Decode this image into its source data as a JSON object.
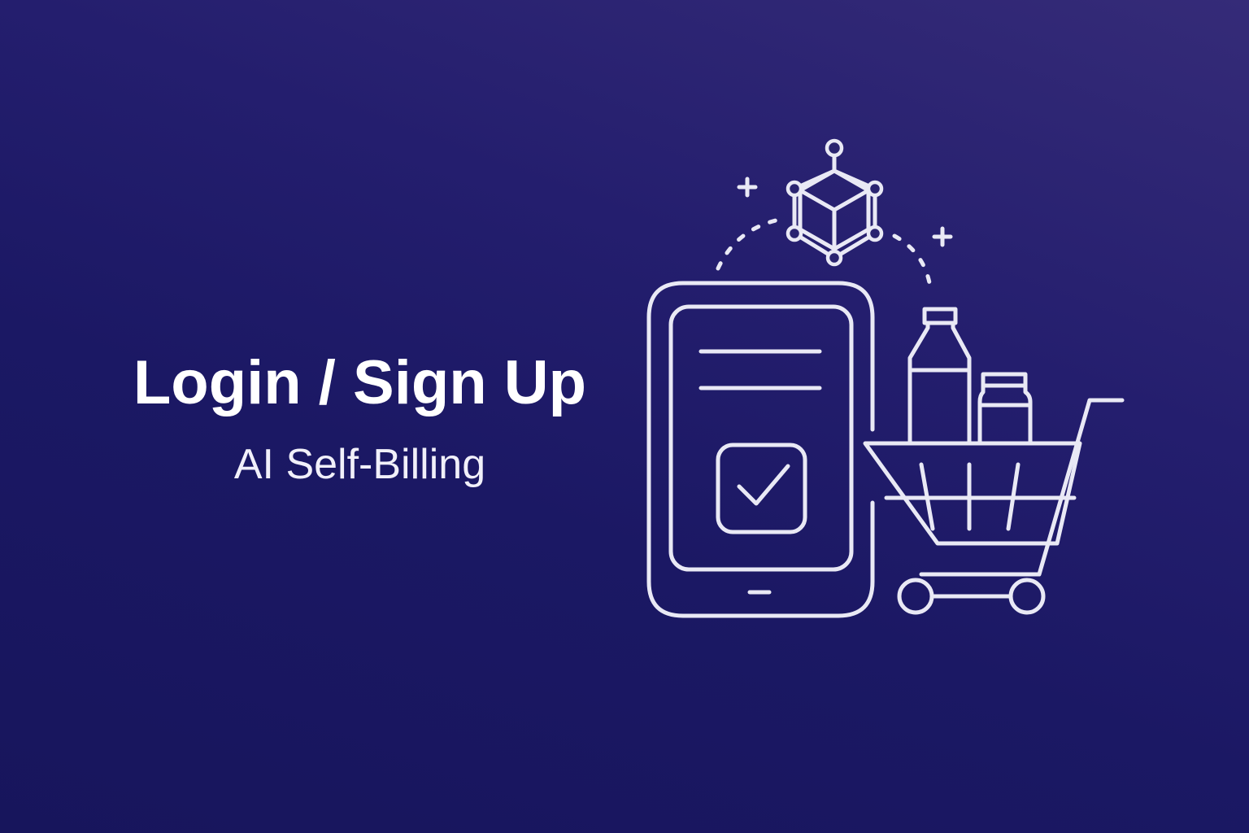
{
  "hero": {
    "title": "Login / Sign Up",
    "subtitle": "AI Self-Billing"
  },
  "illustration": {
    "icons": [
      "ai-cube-icon",
      "tablet-icon",
      "checkbox-check-icon",
      "bottle-icon",
      "jar-icon",
      "shopping-cart-icon",
      "sparkle-plus-icon"
    ]
  },
  "colors": {
    "background_start": "#352b78",
    "background_end": "#17155c",
    "line": "#e9e9f5",
    "text": "#ffffff"
  }
}
